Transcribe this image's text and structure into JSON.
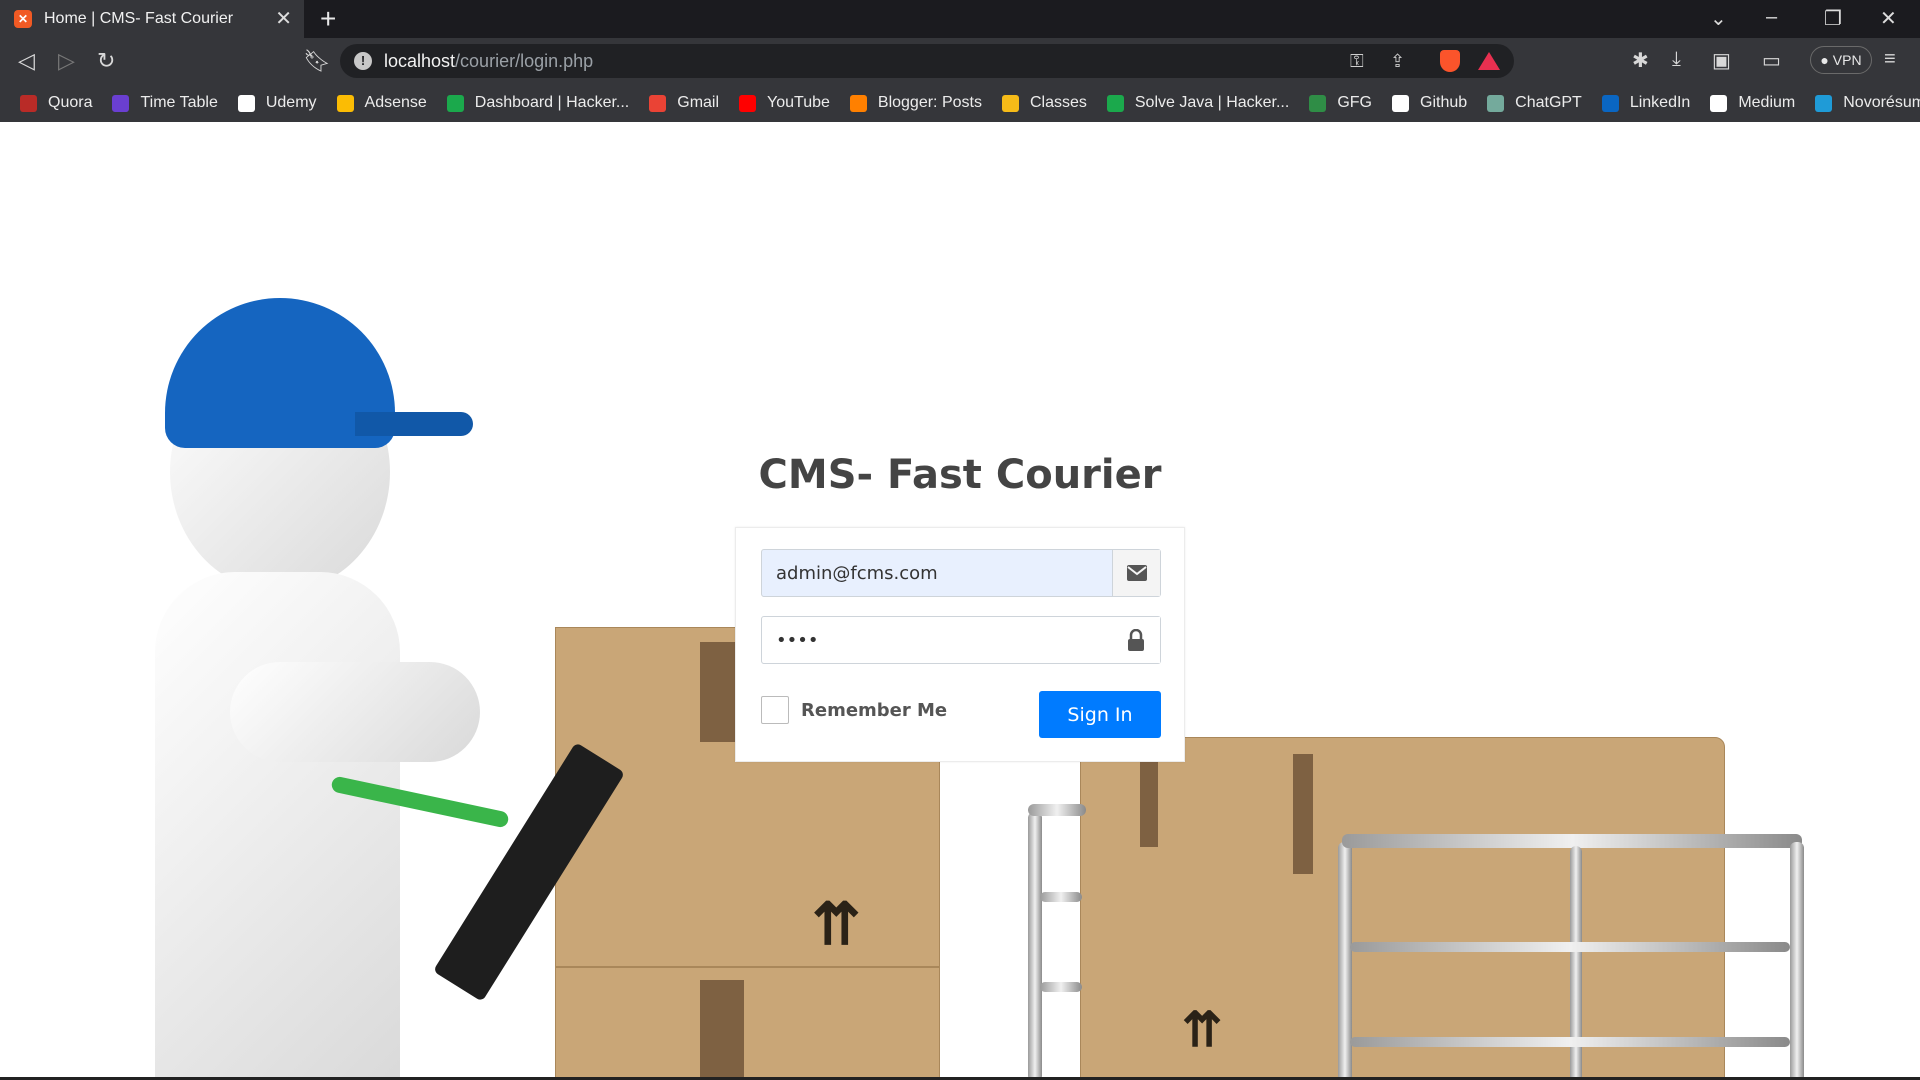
{
  "browser": {
    "tab_title": "Home | CMS- Fast Courier",
    "tab_favicon": "xampp-icon",
    "url_host": "localhost",
    "url_path": "/courier/login.php",
    "vpn_label": "VPN",
    "bookmarks": [
      {
        "label": "Quora",
        "icon": "quora-icon",
        "color": "#b92b27"
      },
      {
        "label": "Time Table",
        "icon": "timetable-icon",
        "color": "#6a3fd1"
      },
      {
        "label": "Udemy",
        "icon": "udemy-icon",
        "color": "#ffffff"
      },
      {
        "label": "Adsense",
        "icon": "adsense-icon",
        "color": "#fbbc04"
      },
      {
        "label": "Dashboard | Hacker...",
        "icon": "hackerrank-icon",
        "color": "#1ba94c"
      },
      {
        "label": "Gmail",
        "icon": "gmail-icon",
        "color": "#ea4335"
      },
      {
        "label": "YouTube",
        "icon": "youtube-icon",
        "color": "#ff0000"
      },
      {
        "label": "Blogger: Posts",
        "icon": "blogger-icon",
        "color": "#ff8000"
      },
      {
        "label": "Classes",
        "icon": "classroom-icon",
        "color": "#f6bb18"
      },
      {
        "label": "Solve Java | Hacker...",
        "icon": "hackerrank-icon",
        "color": "#1ba94c"
      },
      {
        "label": "GFG",
        "icon": "gfg-icon",
        "color": "#2f8d46"
      },
      {
        "label": "Github",
        "icon": "github-icon",
        "color": "#ffffff"
      },
      {
        "label": "ChatGPT",
        "icon": "chatgpt-icon",
        "color": "#74aa9c"
      },
      {
        "label": "LinkedIn",
        "icon": "linkedin-icon",
        "color": "#0a66c2"
      },
      {
        "label": "Medium",
        "icon": "medium-icon",
        "color": "#ffffff"
      },
      {
        "label": "Novorésumé",
        "icon": "novoresume-icon",
        "color": "#1f9bd7"
      }
    ]
  },
  "login": {
    "title": "CMS- Fast Courier",
    "email_value": "admin@fcms.com",
    "password_value": "••••",
    "remember_label": "Remember Me",
    "signin_label": "Sign In"
  },
  "colors": {
    "primary": "#007bff",
    "autofill": "#e8f0fe"
  }
}
